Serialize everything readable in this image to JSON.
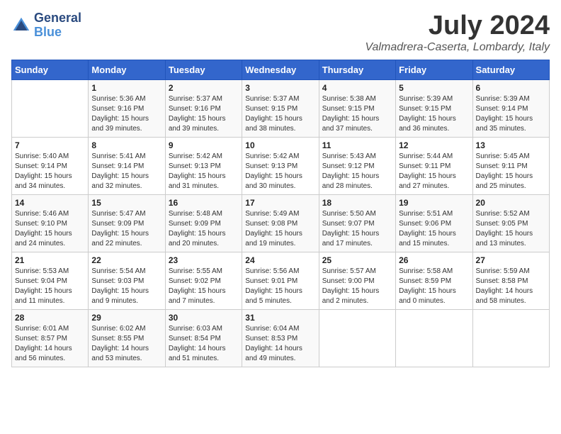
{
  "header": {
    "logo_line1": "General",
    "logo_line2": "Blue",
    "title": "July 2024",
    "subtitle": "Valmadrera-Caserta, Lombardy, Italy"
  },
  "weekdays": [
    "Sunday",
    "Monday",
    "Tuesday",
    "Wednesday",
    "Thursday",
    "Friday",
    "Saturday"
  ],
  "weeks": [
    [
      {
        "day": "",
        "info": ""
      },
      {
        "day": "1",
        "info": "Sunrise: 5:36 AM\nSunset: 9:16 PM\nDaylight: 15 hours\nand 39 minutes."
      },
      {
        "day": "2",
        "info": "Sunrise: 5:37 AM\nSunset: 9:16 PM\nDaylight: 15 hours\nand 39 minutes."
      },
      {
        "day": "3",
        "info": "Sunrise: 5:37 AM\nSunset: 9:15 PM\nDaylight: 15 hours\nand 38 minutes."
      },
      {
        "day": "4",
        "info": "Sunrise: 5:38 AM\nSunset: 9:15 PM\nDaylight: 15 hours\nand 37 minutes."
      },
      {
        "day": "5",
        "info": "Sunrise: 5:39 AM\nSunset: 9:15 PM\nDaylight: 15 hours\nand 36 minutes."
      },
      {
        "day": "6",
        "info": "Sunrise: 5:39 AM\nSunset: 9:14 PM\nDaylight: 15 hours\nand 35 minutes."
      }
    ],
    [
      {
        "day": "7",
        "info": "Sunrise: 5:40 AM\nSunset: 9:14 PM\nDaylight: 15 hours\nand 34 minutes."
      },
      {
        "day": "8",
        "info": "Sunrise: 5:41 AM\nSunset: 9:14 PM\nDaylight: 15 hours\nand 32 minutes."
      },
      {
        "day": "9",
        "info": "Sunrise: 5:42 AM\nSunset: 9:13 PM\nDaylight: 15 hours\nand 31 minutes."
      },
      {
        "day": "10",
        "info": "Sunrise: 5:42 AM\nSunset: 9:13 PM\nDaylight: 15 hours\nand 30 minutes."
      },
      {
        "day": "11",
        "info": "Sunrise: 5:43 AM\nSunset: 9:12 PM\nDaylight: 15 hours\nand 28 minutes."
      },
      {
        "day": "12",
        "info": "Sunrise: 5:44 AM\nSunset: 9:11 PM\nDaylight: 15 hours\nand 27 minutes."
      },
      {
        "day": "13",
        "info": "Sunrise: 5:45 AM\nSunset: 9:11 PM\nDaylight: 15 hours\nand 25 minutes."
      }
    ],
    [
      {
        "day": "14",
        "info": "Sunrise: 5:46 AM\nSunset: 9:10 PM\nDaylight: 15 hours\nand 24 minutes."
      },
      {
        "day": "15",
        "info": "Sunrise: 5:47 AM\nSunset: 9:09 PM\nDaylight: 15 hours\nand 22 minutes."
      },
      {
        "day": "16",
        "info": "Sunrise: 5:48 AM\nSunset: 9:09 PM\nDaylight: 15 hours\nand 20 minutes."
      },
      {
        "day": "17",
        "info": "Sunrise: 5:49 AM\nSunset: 9:08 PM\nDaylight: 15 hours\nand 19 minutes."
      },
      {
        "day": "18",
        "info": "Sunrise: 5:50 AM\nSunset: 9:07 PM\nDaylight: 15 hours\nand 17 minutes."
      },
      {
        "day": "19",
        "info": "Sunrise: 5:51 AM\nSunset: 9:06 PM\nDaylight: 15 hours\nand 15 minutes."
      },
      {
        "day": "20",
        "info": "Sunrise: 5:52 AM\nSunset: 9:05 PM\nDaylight: 15 hours\nand 13 minutes."
      }
    ],
    [
      {
        "day": "21",
        "info": "Sunrise: 5:53 AM\nSunset: 9:04 PM\nDaylight: 15 hours\nand 11 minutes."
      },
      {
        "day": "22",
        "info": "Sunrise: 5:54 AM\nSunset: 9:03 PM\nDaylight: 15 hours\nand 9 minutes."
      },
      {
        "day": "23",
        "info": "Sunrise: 5:55 AM\nSunset: 9:02 PM\nDaylight: 15 hours\nand 7 minutes."
      },
      {
        "day": "24",
        "info": "Sunrise: 5:56 AM\nSunset: 9:01 PM\nDaylight: 15 hours\nand 5 minutes."
      },
      {
        "day": "25",
        "info": "Sunrise: 5:57 AM\nSunset: 9:00 PM\nDaylight: 15 hours\nand 2 minutes."
      },
      {
        "day": "26",
        "info": "Sunrise: 5:58 AM\nSunset: 8:59 PM\nDaylight: 15 hours\nand 0 minutes."
      },
      {
        "day": "27",
        "info": "Sunrise: 5:59 AM\nSunset: 8:58 PM\nDaylight: 14 hours\nand 58 minutes."
      }
    ],
    [
      {
        "day": "28",
        "info": "Sunrise: 6:01 AM\nSunset: 8:57 PM\nDaylight: 14 hours\nand 56 minutes."
      },
      {
        "day": "29",
        "info": "Sunrise: 6:02 AM\nSunset: 8:55 PM\nDaylight: 14 hours\nand 53 minutes."
      },
      {
        "day": "30",
        "info": "Sunrise: 6:03 AM\nSunset: 8:54 PM\nDaylight: 14 hours\nand 51 minutes."
      },
      {
        "day": "31",
        "info": "Sunrise: 6:04 AM\nSunset: 8:53 PM\nDaylight: 14 hours\nand 49 minutes."
      },
      {
        "day": "",
        "info": ""
      },
      {
        "day": "",
        "info": ""
      },
      {
        "day": "",
        "info": ""
      }
    ]
  ]
}
